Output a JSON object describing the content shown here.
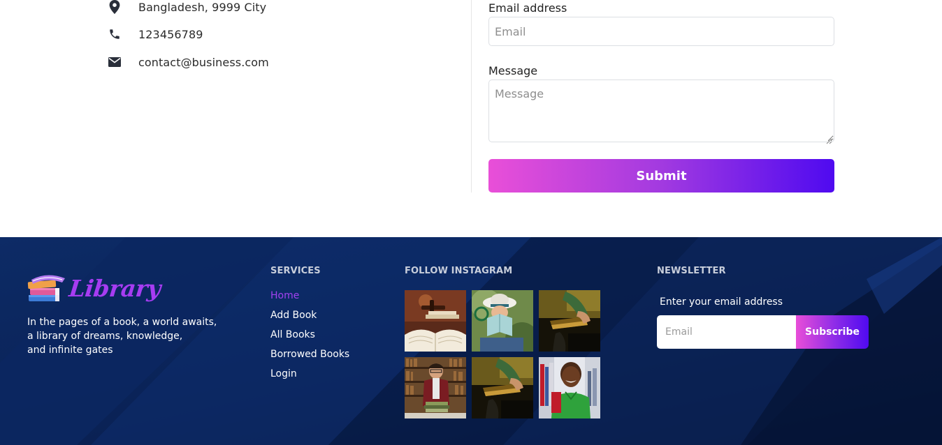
{
  "contact": {
    "address": "Bangladesh, 9999 City",
    "phone": "123456789",
    "email": "contact@business.com"
  },
  "form": {
    "email_label": "Email address",
    "email_placeholder": "Email",
    "message_label": "Message",
    "message_placeholder": "Message",
    "submit_label": "Submit"
  },
  "footer": {
    "logo_text": "Library",
    "tagline": [
      "In the pages of a book, a world awaits,",
      "a library of dreams, knowledge,",
      "and infinite gates"
    ],
    "services_title": "SERVICES",
    "services": [
      {
        "label": "Home",
        "active": true
      },
      {
        "label": "Add Book",
        "active": false
      },
      {
        "label": "All Books",
        "active": false
      },
      {
        "label": "Borrowed Books",
        "active": false
      },
      {
        "label": "Login",
        "active": false
      }
    ],
    "instagram_title": "FOLLOW INSTAGRAM",
    "instagram_images": [
      "open-book-with-gavel",
      "woman-reading-book",
      "person-holding-book-dark",
      "student-with-book-stack",
      "person-holding-book-dark",
      "smiling-student-in-library"
    ],
    "newsletter_title": "NEWSLETTER",
    "newsletter_label": "Enter your email address",
    "newsletter_placeholder": "Email",
    "subscribe_label": "Subscribe"
  },
  "colors": {
    "accent_purple": "#a242f0",
    "gradient_start": "#e94fd8",
    "gradient_end": "#4f0af0",
    "footer_bg": "#0a2256"
  }
}
